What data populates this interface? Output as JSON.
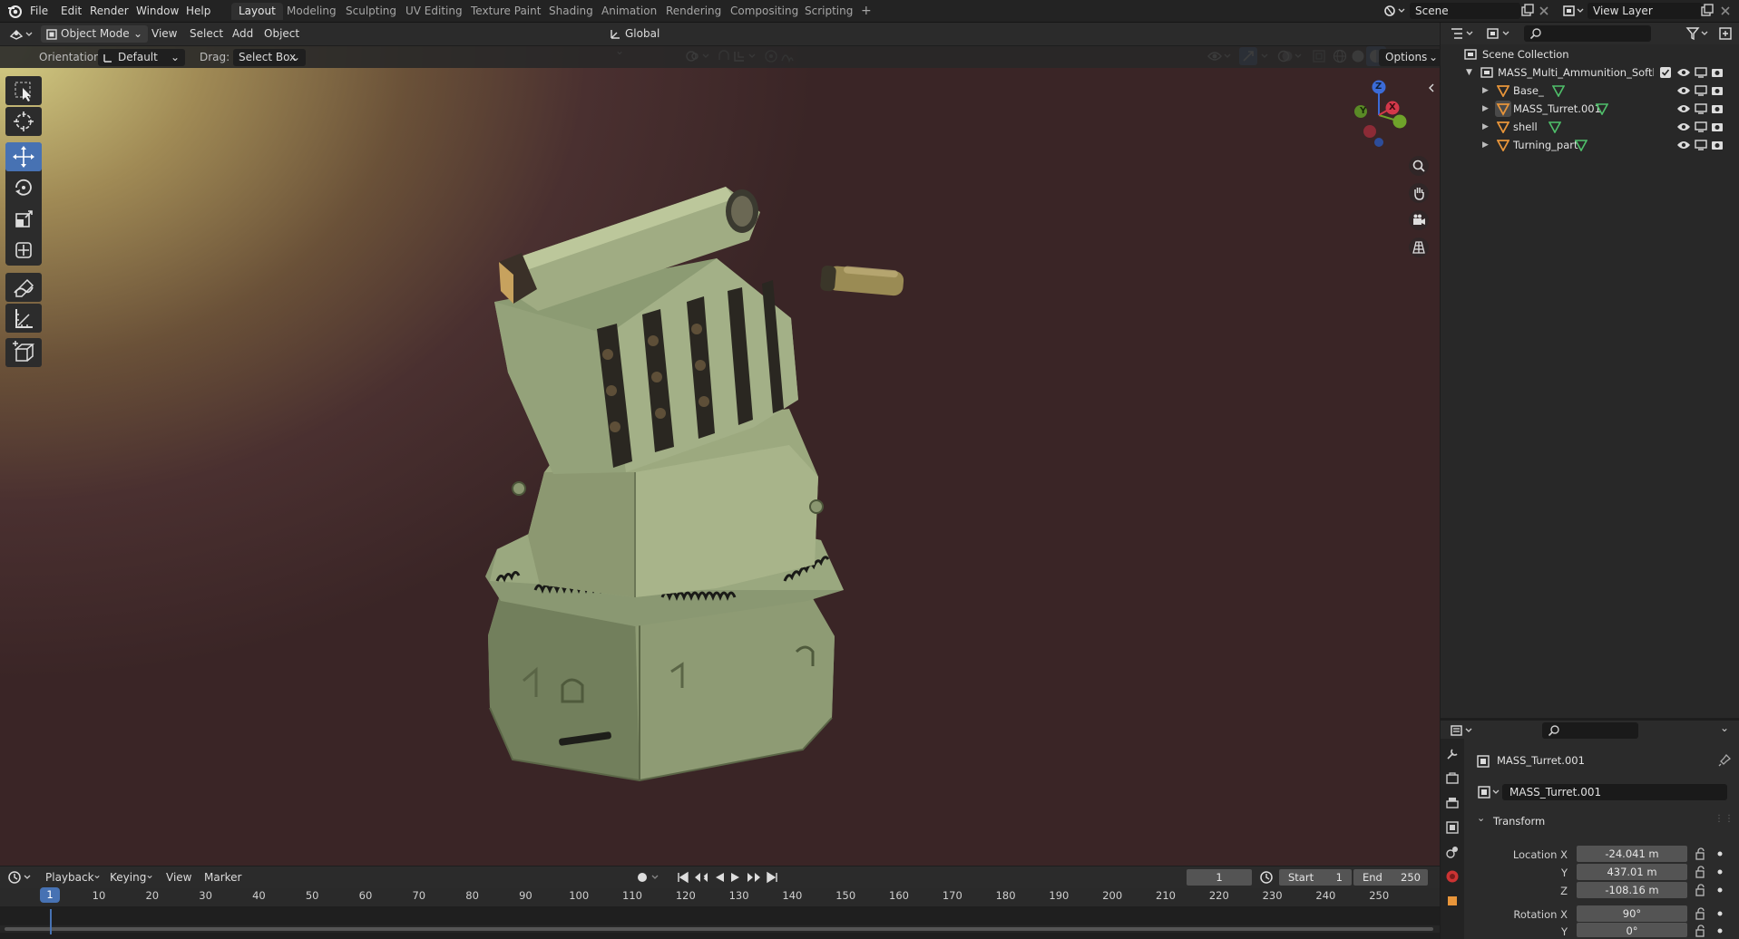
{
  "topbar": {
    "menus": [
      "File",
      "Edit",
      "Render",
      "Window",
      "Help"
    ],
    "workspaces": [
      "Layout",
      "Modeling",
      "Sculpting",
      "UV Editing",
      "Texture Paint",
      "Shading",
      "Animation",
      "Rendering",
      "Compositing",
      "Scripting",
      "+"
    ],
    "active_workspace": "Layout",
    "scene": "Scene",
    "view_layer": "View Layer"
  },
  "viewport_header": {
    "mode": "Object Mode",
    "menus": [
      "View",
      "Select",
      "Add",
      "Object"
    ],
    "transform_orientation": "Global",
    "options": "Options"
  },
  "tool_settings": {
    "orientation_label": "Orientation:",
    "orientation_value": "Default",
    "drag_label": "Drag:",
    "drag_value": "Select Box"
  },
  "gizmo": {
    "x": "X",
    "y": "Y",
    "z": "Z"
  },
  "outliner": {
    "root": "Scene Collection",
    "collection": "MASS_Multi_Ammunition_Softkill_Sy",
    "objects": [
      "Base_",
      "MASS_Turret.001",
      "shell",
      "Turning_part"
    ]
  },
  "properties": {
    "object_name": "MASS_Turret.001",
    "data_name": "MASS_Turret.001",
    "panel": "Transform",
    "location_label": "Location X",
    "location": {
      "x": "-24.041 m",
      "y": "437.01 m",
      "z": "-108.16 m"
    },
    "axis_y": "Y",
    "axis_z": "Z",
    "rotation_label": "Rotation X",
    "rotation": {
      "x": "90°",
      "y": "0°"
    }
  },
  "timeline": {
    "menus": [
      "Playback",
      "Keying",
      "View",
      "Marker"
    ],
    "current_frame": "1",
    "start_label": "Start",
    "start": "1",
    "end_label": "End",
    "end": "250",
    "ticks": [
      "10",
      "20",
      "30",
      "40",
      "50",
      "60",
      "70",
      "80",
      "90",
      "100",
      "110",
      "120",
      "130",
      "140",
      "150",
      "160",
      "170",
      "180",
      "190",
      "200",
      "210",
      "220",
      "230",
      "240",
      "250"
    ],
    "playhead": "1"
  }
}
